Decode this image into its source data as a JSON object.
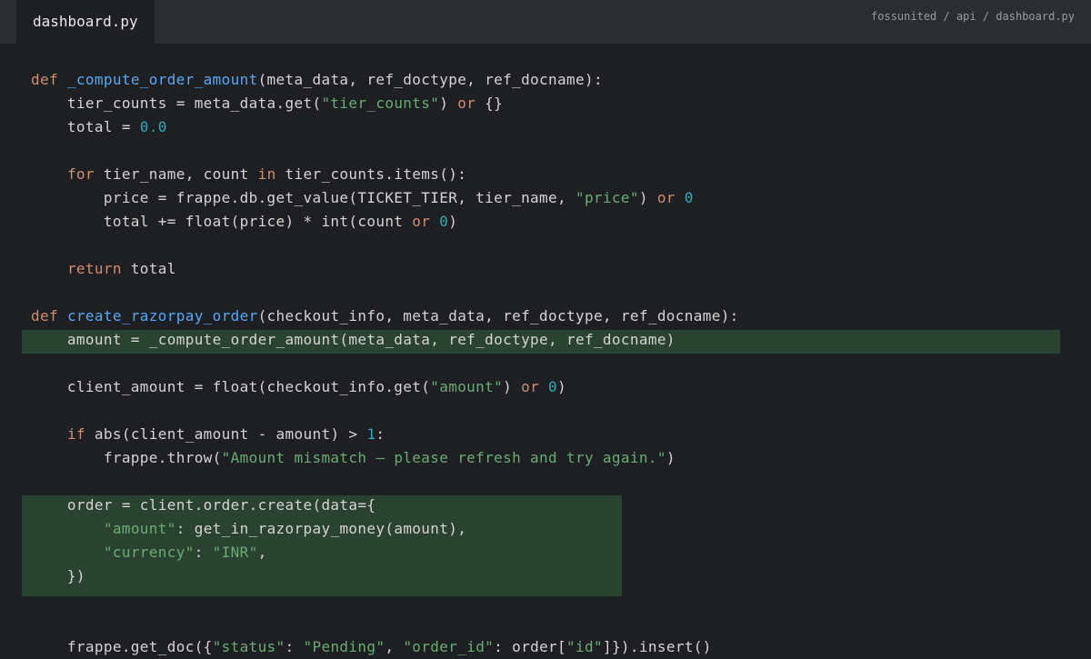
{
  "tab": {
    "filename": "dashboard.py"
  },
  "breadcrumb": "fossunited / api / dashboard.py",
  "code_lines": [
    [
      [
        "kw",
        "def "
      ],
      [
        "fn",
        "_compute_order_amount"
      ],
      [
        "plain",
        "(meta_data, ref_doctype, ref_docname):"
      ]
    ],
    [
      [
        "plain",
        "    tier_counts = meta_data.get("
      ],
      [
        "str",
        "\"tier_counts\""
      ],
      [
        "plain",
        ") "
      ],
      [
        "kw",
        "or"
      ],
      [
        "plain",
        " {}"
      ]
    ],
    [
      [
        "plain",
        "    total = "
      ],
      [
        "num",
        "0.0"
      ]
    ],
    [],
    [
      [
        "plain",
        "    "
      ],
      [
        "kw",
        "for"
      ],
      [
        "plain",
        " tier_name, count "
      ],
      [
        "kw",
        "in"
      ],
      [
        "plain",
        " tier_counts.items():"
      ]
    ],
    [
      [
        "plain",
        "        price = frappe.db.get_value(TICKET_TIER, tier_name, "
      ],
      [
        "str",
        "\"price\""
      ],
      [
        "plain",
        ") "
      ],
      [
        "kw",
        "or"
      ],
      [
        "plain",
        " "
      ],
      [
        "num",
        "0"
      ]
    ],
    [
      [
        "plain",
        "        total += float(price) * int(count "
      ],
      [
        "kw",
        "or"
      ],
      [
        "plain",
        " "
      ],
      [
        "num",
        "0"
      ],
      [
        "plain",
        ")"
      ]
    ],
    [],
    [
      [
        "plain",
        "    "
      ],
      [
        "kw",
        "return"
      ],
      [
        "plain",
        " total"
      ]
    ],
    [],
    [
      [
        "kw",
        "def "
      ],
      [
        "fn",
        "create_razorpay_order"
      ],
      [
        "plain",
        "(checkout_info, meta_data, ref_doctype, ref_docname):"
      ]
    ],
    [
      [
        "plain",
        "    amount = _compute_order_amount(meta_data, ref_doctype, ref_docname)"
      ]
    ],
    [],
    [
      [
        "plain",
        "    client_amount = float(checkout_info.get("
      ],
      [
        "str",
        "\"amount\""
      ],
      [
        "plain",
        ") "
      ],
      [
        "kw",
        "or"
      ],
      [
        "plain",
        " "
      ],
      [
        "num",
        "0"
      ],
      [
        "plain",
        ")"
      ]
    ],
    [],
    [
      [
        "plain",
        "    "
      ],
      [
        "kw",
        "if"
      ],
      [
        "plain",
        " abs(client_amount - amount) > "
      ],
      [
        "num",
        "1"
      ],
      [
        "plain",
        ":"
      ]
    ],
    [
      [
        "plain",
        "        frappe.throw("
      ],
      [
        "str",
        "\"Amount mismatch — please refresh and try again.\""
      ],
      [
        "plain",
        ")"
      ]
    ],
    [],
    [
      [
        "plain",
        "    order = client.order.create(data={"
      ]
    ],
    [
      [
        "plain",
        "        "
      ],
      [
        "str",
        "\"amount\""
      ],
      [
        "plain",
        ": get_in_razorpay_money(amount),"
      ]
    ],
    [
      [
        "plain",
        "        "
      ],
      [
        "str",
        "\"currency\""
      ],
      [
        "plain",
        ": "
      ],
      [
        "str",
        "\"INR\""
      ],
      [
        "plain",
        ","
      ]
    ],
    [
      [
        "plain",
        "    })"
      ]
    ],
    [],
    [],
    [
      [
        "plain",
        "    frappe.get_doc({"
      ],
      [
        "str",
        "\"status\""
      ],
      [
        "plain",
        ": "
      ],
      [
        "str",
        "\"Pending\""
      ],
      [
        "plain",
        ", "
      ],
      [
        "str",
        "\"order_id\""
      ],
      [
        "plain",
        ": order["
      ],
      [
        "str",
        "\"id\""
      ],
      [
        "plain",
        "]}).insert()"
      ]
    ]
  ],
  "highlighted_lines": [
    11,
    18,
    19,
    20,
    21
  ]
}
